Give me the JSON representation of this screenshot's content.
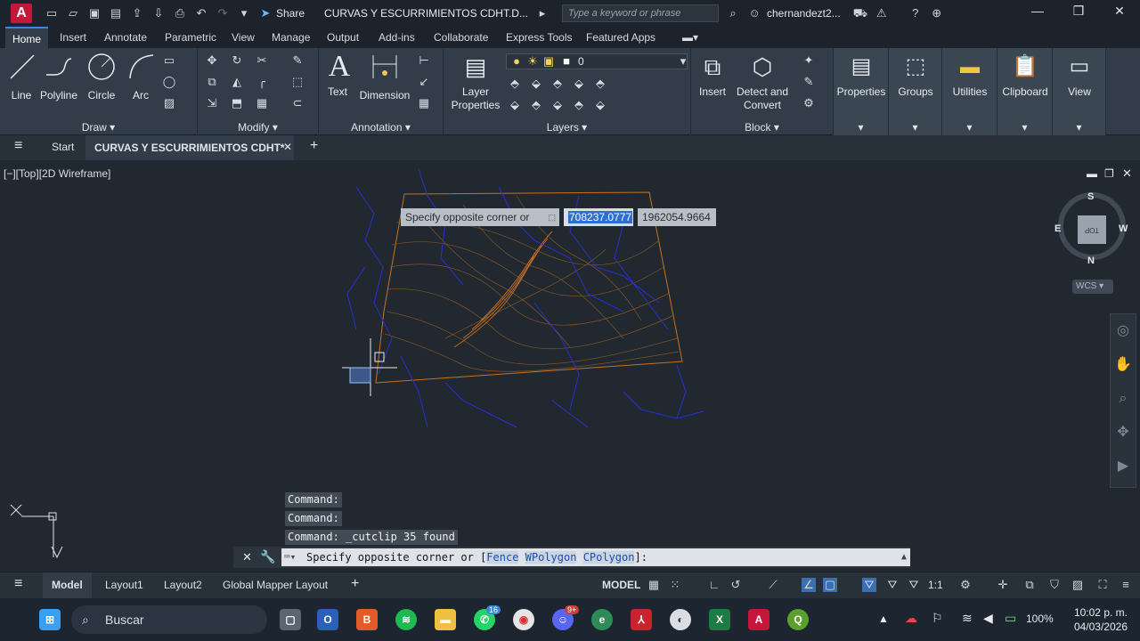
{
  "titlebar": {
    "app_letter": "A",
    "share_label": "Share",
    "document_title": "CURVAS Y ESCURRIMIENTOS CDHT.D...",
    "search_placeholder": "Type a keyword or phrase",
    "user_name": "chernandezt2...",
    "minimize": "—",
    "restore": "❐",
    "close": "✕"
  },
  "ribbon_tabs": [
    "Home",
    "Insert",
    "Annotate",
    "Parametric",
    "View",
    "Manage",
    "Output",
    "Add-ins",
    "Collaborate",
    "Express Tools",
    "Featured Apps"
  ],
  "ribbon": {
    "draw": {
      "title": "Draw",
      "line": "Line",
      "polyline": "Polyline",
      "circle": "Circle",
      "arc": "Arc"
    },
    "modify": {
      "title": "Modify"
    },
    "annotation": {
      "title": "Annotation",
      "text": "Text",
      "dimension": "Dimension"
    },
    "layers": {
      "title": "Layers",
      "layer_properties_1": "Layer",
      "layer_properties_2": "Properties",
      "current_layer": "0"
    },
    "block": {
      "title": "Block",
      "insert": "Insert",
      "detect_1": "Detect and",
      "detect_2": "Convert"
    },
    "properties": "Properties",
    "groups": "Groups",
    "utilities": "Utilities",
    "clipboard": "Clipboard",
    "view": "View"
  },
  "doc_tabs": {
    "start": "Start",
    "active": "CURVAS Y ESCURRIMIENTOS CDHT*",
    "close": "✕",
    "new": "+"
  },
  "canvas": {
    "viewport_label": "[−][Top][2D Wireframe]",
    "tooltip_prompt": "Specify opposite corner or",
    "coord_x": "708237.0777",
    "coord_y": "1962054.9664",
    "viewcube": {
      "north": "N",
      "south": "S",
      "east": "E",
      "west": "W",
      "face": "TOP",
      "wcs": "WCS"
    }
  },
  "command_history": [
    "Command:",
    "Command:",
    "Command: _cutclip 35 found"
  ],
  "command_line": {
    "prefix": "Specify opposite corner or [",
    "option1": "Fence",
    "option2": "WPolygon",
    "option3": "CPolygon",
    "suffix": "]:"
  },
  "statusbar": {
    "tabs": [
      "Model",
      "Layout1",
      "Layout2",
      "Global Mapper Layout"
    ],
    "space": "MODEL",
    "scale": "1:1"
  },
  "taskbar": {
    "search_label": "Buscar",
    "battery": "100%",
    "time": "10:02 p. m.",
    "date": "04/03/2026",
    "whatsapp_badge": "16",
    "discord_badge": "9+"
  },
  "colors": {
    "accent": "#3b88d8",
    "autocad_red": "#c4173b",
    "contour_orange": "#c8731a",
    "stream_blue": "#2a2fd0"
  }
}
